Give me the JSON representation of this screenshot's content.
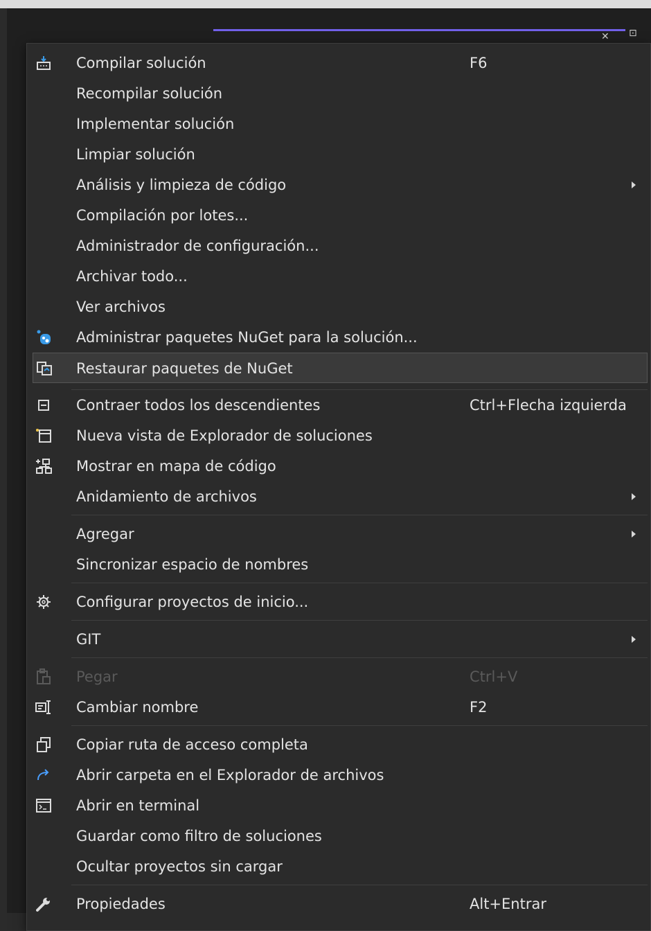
{
  "background": {
    "tab_close_glyph": "✕",
    "side_glyph": "⊡"
  },
  "menu": {
    "items": [
      {
        "label": "Compilar solución",
        "shortcut": "F6",
        "icon": "build-icon"
      },
      {
        "label": "Recompilar solución"
      },
      {
        "label": "Implementar solución"
      },
      {
        "label": "Limpiar solución"
      },
      {
        "label": "Análisis y limpieza de código",
        "submenu": true
      },
      {
        "label": "Compilación por lotes..."
      },
      {
        "label": "Administrador de configuración..."
      },
      {
        "label": "Archivar todo..."
      },
      {
        "label": "Ver archivos"
      },
      {
        "label": "Administrar paquetes NuGet para la solución...",
        "icon": "nuget-icon"
      },
      {
        "label": "Restaurar paquetes de NuGet",
        "icon": "restore-packages-icon",
        "hovered": true
      },
      {
        "label": "Contraer todos los descendientes",
        "shortcut": "Ctrl+Flecha izquierda",
        "icon": "collapse-icon"
      },
      {
        "label": "Nueva vista de Explorador de soluciones",
        "icon": "new-view-icon"
      },
      {
        "label": "Mostrar en mapa de código",
        "icon": "code-map-icon"
      },
      {
        "label": "Anidamiento de archivos",
        "submenu": true
      },
      {
        "label": "Agregar",
        "submenu": true
      },
      {
        "label": "Sincronizar espacio de nombres"
      },
      {
        "label": "Configurar proyectos de inicio...",
        "icon": "gear-icon"
      },
      {
        "label": "GIT",
        "submenu": true
      },
      {
        "label": "Pegar",
        "shortcut": "Ctrl+V",
        "icon": "paste-icon",
        "disabled": true
      },
      {
        "label": "Cambiar nombre",
        "shortcut": "F2",
        "icon": "rename-icon"
      },
      {
        "label": "Copiar ruta de acceso completa",
        "icon": "copy-icon"
      },
      {
        "label": "Abrir carpeta en el Explorador de archivos",
        "icon": "open-folder-arrow-icon"
      },
      {
        "label": "Abrir en terminal",
        "icon": "terminal-icon"
      },
      {
        "label": "Guardar como filtro de soluciones"
      },
      {
        "label": "Ocultar proyectos sin cargar"
      },
      {
        "label": "Propiedades",
        "shortcut": "Alt+Entrar",
        "icon": "wrench-icon"
      }
    ]
  },
  "colors": {
    "menu_background": "#2b2b2b",
    "text": "#e4e4e4",
    "disabled_text": "#5a5a5a",
    "accent_tab": "#7160e8",
    "nuget_blue": "#3a9be8",
    "link_blue": "#4a9fff"
  }
}
